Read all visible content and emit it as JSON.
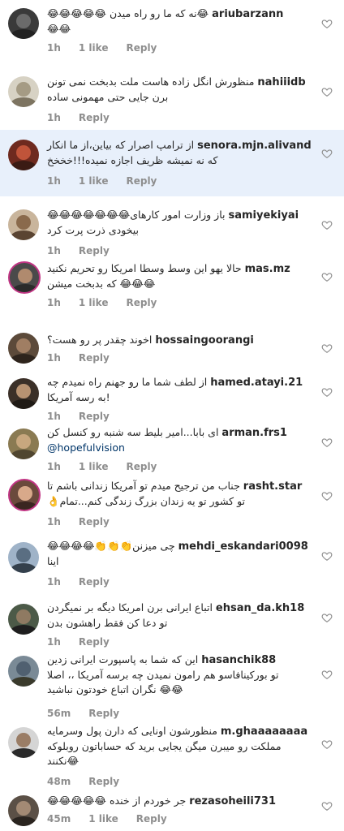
{
  "labels": {
    "reply": "Reply"
  },
  "colors": {
    "highlight": "#e8f0fb",
    "meta": "#8e8e8e",
    "mention": "#003569"
  },
  "comments": [
    {
      "user": "ariubarzann",
      "text": "😂نه که ما رو راه میدن 😂😂😂😂😂",
      "text2": "😂😂",
      "time": "1h",
      "likes": "1 like"
    },
    {
      "user": "nahiiidb",
      "text": "منظورش انگل زاده هاست ملت بدبخت نمی تونن",
      "text2": "برن جایی حتی مهمونی ساده",
      "time": "1h",
      "likes": ""
    },
    {
      "user": "senora.mjn.alivand",
      "text": "از ترامپ اصرار که بیاین،از ما انکار",
      "text2": "که نه نمیشه ظریف اجازه نمیده!!!خخخخ",
      "time": "1h",
      "likes": "1 like"
    },
    {
      "user": "samiyekiyai",
      "text": "باز وزارت امور کارهای😂😂😂😂😂😂😂",
      "text2": "بیخودی ذرت پرت کرد",
      "time": "1h",
      "likes": ""
    },
    {
      "user": "mas.mz",
      "text": "حالا یهو این وسط وسطا امریکا رو تحریم نکنید",
      "text2": "😂😂😂 که بدبخت میشن",
      "time": "1h",
      "likes": "1 like"
    },
    {
      "user": "hossaingoorangi",
      "text": "اخوند چقدر پر رو هست؟",
      "text2": "",
      "time": "1h",
      "likes": ""
    },
    {
      "user": "hamed.atayi.21",
      "text": "از لطف شما ما رو جهنم راه نمیدم چه",
      "text2": "!به رسه آمریکا",
      "time": "1h",
      "likes": ""
    },
    {
      "user": "arman.frs1",
      "text": "ای بابا...امیر بلیط سه شنبه رو کنسل کن",
      "mention": "@hopefulvision",
      "text2": "",
      "time": "1h",
      "likes": "1 like"
    },
    {
      "user": "rasht.star",
      "text": "جناب من ترجیح میدم تو آمریکا زندانی باشم تا",
      "text2": "تو کشور تو یه زندان بزرگ زندگی کنم...تمام👌",
      "time": "1h",
      "likes": ""
    },
    {
      "user": "mehdi_eskandari0098",
      "text": "چی میزنن👏👏👏😂😂😂😂",
      "text2": "اینا",
      "time": "1h",
      "likes": ""
    },
    {
      "user": "ehsan_da.kh18",
      "text": "اتباع ایرانی برن امریکا دیگه بر نمیگردن",
      "text2": "تو دعا کن فقط راهشون بدن",
      "time": "1h",
      "likes": ""
    },
    {
      "user": "hasanchik88",
      "text": "این که شما به پاسپورت ایرانی زدین",
      "text2": "تو بورکینافاسو هم رامون نمیدن چه برسه آمریکا ،، اصلا",
      "text3": "😂😂 نگران اتباع خودتون نباشید",
      "time": "56m",
      "likes": ""
    },
    {
      "user": "m.ghaaaaaaaa",
      "text": "منظورشون اونایی که دارن پول وسرمایه",
      "text2": "مملکت رو میبرن میگن یجایی برید که حساباتون روبلوکه",
      "text3": "😂نکنند",
      "time": "48m",
      "likes": ""
    },
    {
      "user": "rezasoheili731",
      "text": "جر خوردم از خنده 😂😂😂😂😂",
      "text2": "",
      "time": "45m",
      "likes": "1 like"
    }
  ]
}
